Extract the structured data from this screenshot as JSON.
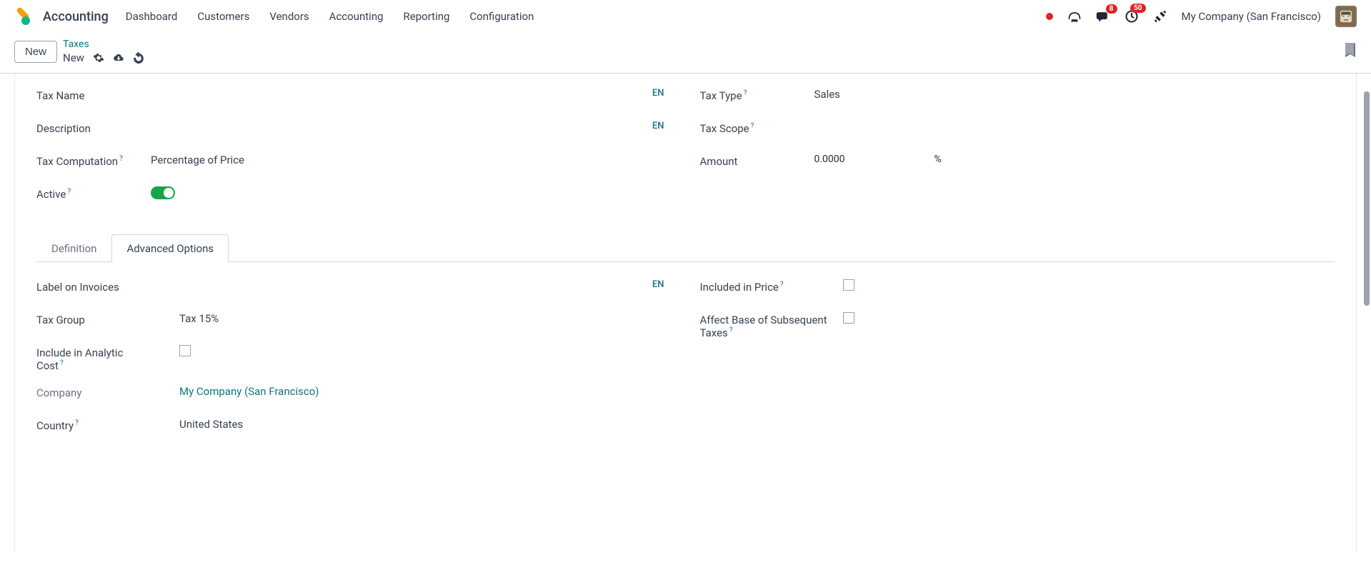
{
  "app": {
    "title": "Accounting"
  },
  "nav": {
    "dashboard": "Dashboard",
    "customers": "Customers",
    "vendors": "Vendors",
    "accounting": "Accounting",
    "reporting": "Reporting",
    "configuration": "Configuration"
  },
  "header": {
    "messages_badge": "8",
    "activities_badge": "50",
    "company": "My Company (San Francisco)"
  },
  "breadcrumb": {
    "new_button": "New",
    "parent": "Taxes",
    "current": "New"
  },
  "form": {
    "tax_name_label": "Tax Name",
    "description_label": "Description",
    "tax_computation_label": "Tax Computation",
    "tax_computation_value": "Percentage of Price",
    "active_label": "Active",
    "tax_type_label": "Tax Type",
    "tax_type_value": "Sales",
    "tax_scope_label": "Tax Scope",
    "amount_label": "Amount",
    "amount_value": "0.0000",
    "amount_suffix": "%",
    "lang": "EN"
  },
  "tabs": {
    "definition": "Definition",
    "advanced": "Advanced Options"
  },
  "advanced": {
    "label_invoices": "Label on Invoices",
    "tax_group_label": "Tax Group",
    "tax_group_value": "Tax 15%",
    "include_analytic_label": "Include in Analytic Cost",
    "company_label": "Company",
    "company_value": "My Company (San Francisco)",
    "country_label": "Country",
    "country_value": "United States",
    "included_price_label": "Included in Price",
    "affect_base_label": "Affect Base of Subsequent Taxes"
  }
}
